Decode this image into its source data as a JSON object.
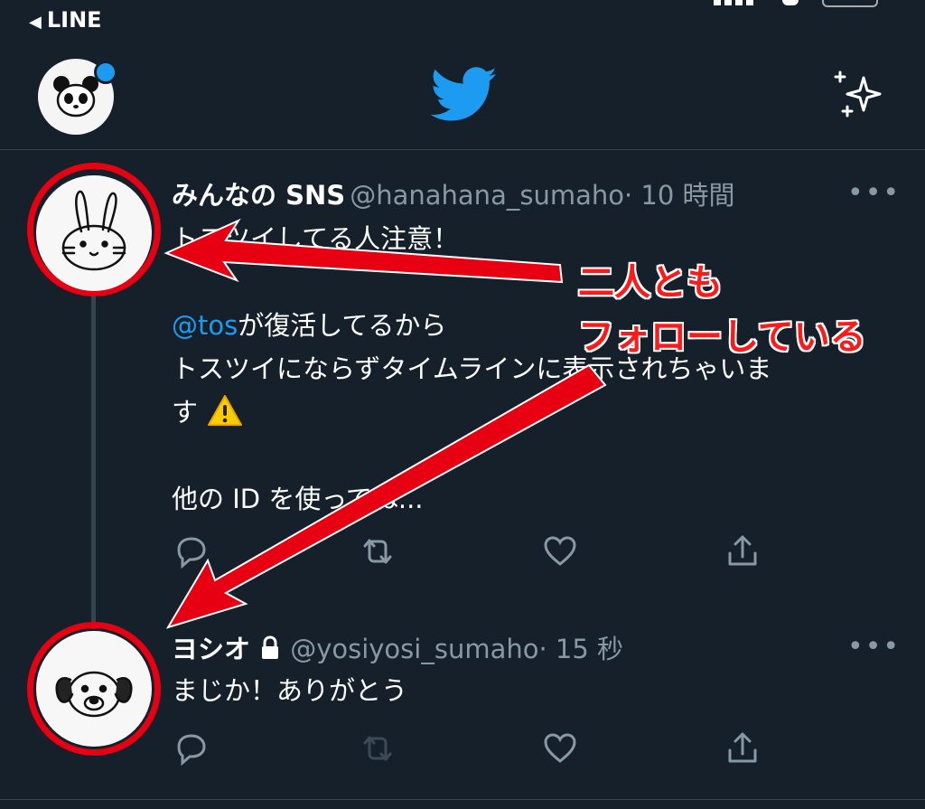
{
  "statusbar": {
    "back_label": "LINE"
  },
  "header": {
    "profile_icon": "panda-avatar",
    "logo_icon": "twitter-bird-icon",
    "sparkle_icon": "sparkle-icon"
  },
  "tweets": [
    {
      "name": "みんなの SNS",
      "handle": "@hanahana_sumaho",
      "time": "· 10 時間",
      "avatar": "rabbit-avatar",
      "line1": "トスツイしてる人注意！",
      "mention": "@tos",
      "line2_rest": "が復活してるから",
      "line3": "トスツイにならずタイムラインに表示されちゃいま",
      "line4": "す",
      "line5": "他の ID を使ってね...",
      "more": "•••"
    },
    {
      "name": "ヨシオ",
      "handle": "@yosiyosi_sumaho",
      "time": "· 15 秒",
      "avatar": "dog-avatar",
      "text": "まじか！ありがとう",
      "more": "•••"
    }
  ],
  "annotation": {
    "line1": "二人とも",
    "line2": "フォローしている",
    "color": "#ff1a1a"
  },
  "colors": {
    "background": "#15202b",
    "accent": "#1d9bf0",
    "muted": "#8899a6",
    "annotation": "#e60012"
  }
}
